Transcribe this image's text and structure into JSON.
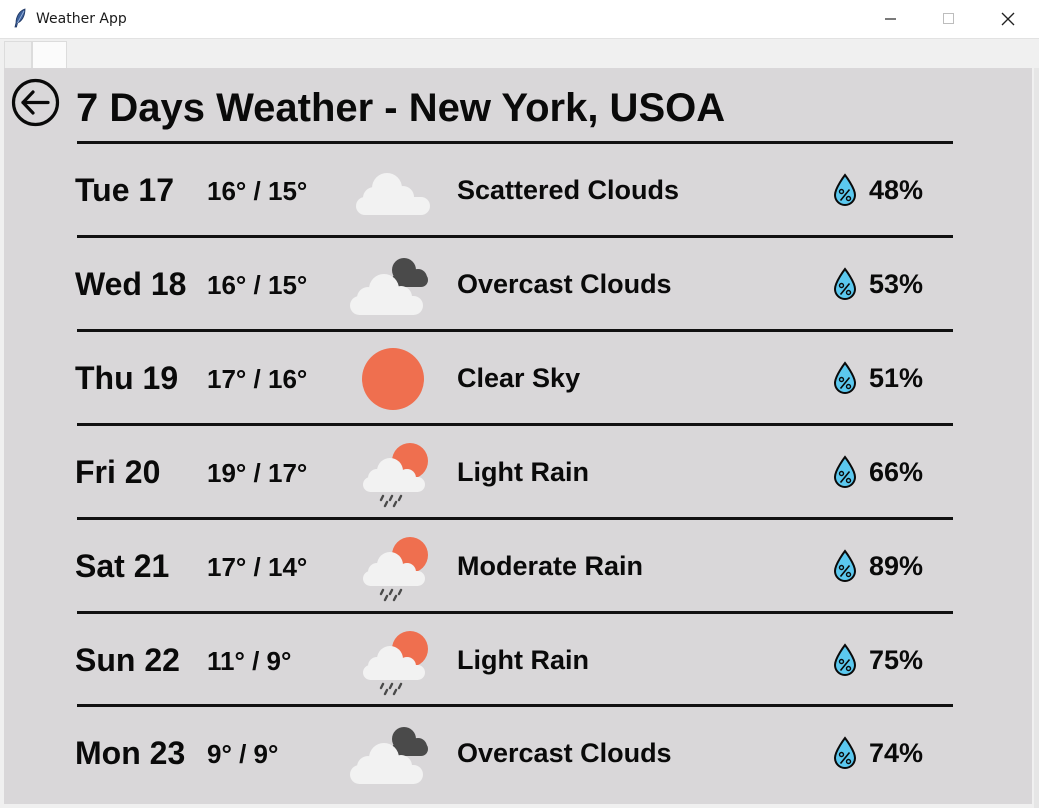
{
  "window": {
    "title": "Weather App"
  },
  "page": {
    "title": "7 Days Weather - New York, USOA"
  },
  "colors": {
    "background": "#d9d7d9",
    "sun": "#ef6f4f",
    "cloud_light": "#f2f2f2",
    "cloud_dark": "#4a4a4a",
    "drop": "#5bc8ef"
  },
  "days": [
    {
      "day": "Tue 17",
      "temp": "16° / 15°",
      "icon": "scattered-clouds-icon",
      "desc": "Scattered Clouds",
      "humidity": "48%"
    },
    {
      "day": "Wed 18",
      "temp": "16° / 15°",
      "icon": "overcast-clouds-icon",
      "desc": "Overcast Clouds",
      "humidity": "53%"
    },
    {
      "day": "Thu 19",
      "temp": "17° / 16°",
      "icon": "clear-sky-sun-icon",
      "desc": "Clear Sky",
      "humidity": "51%"
    },
    {
      "day": "Fri 20",
      "temp": "19° / 17°",
      "icon": "rain-sun-cloud-icon",
      "desc": "Light Rain",
      "humidity": "66%"
    },
    {
      "day": "Sat 21",
      "temp": "17° / 14°",
      "icon": "rain-sun-cloud-icon",
      "desc": "Moderate Rain",
      "humidity": "89%"
    },
    {
      "day": "Sun 22",
      "temp": "11° / 9°",
      "icon": "rain-sun-cloud-icon",
      "desc": "Light Rain",
      "humidity": "75%"
    },
    {
      "day": "Mon 23",
      "temp": "9° / 9°",
      "icon": "overcast-clouds-icon",
      "desc": "Overcast Clouds",
      "humidity": "74%"
    }
  ]
}
